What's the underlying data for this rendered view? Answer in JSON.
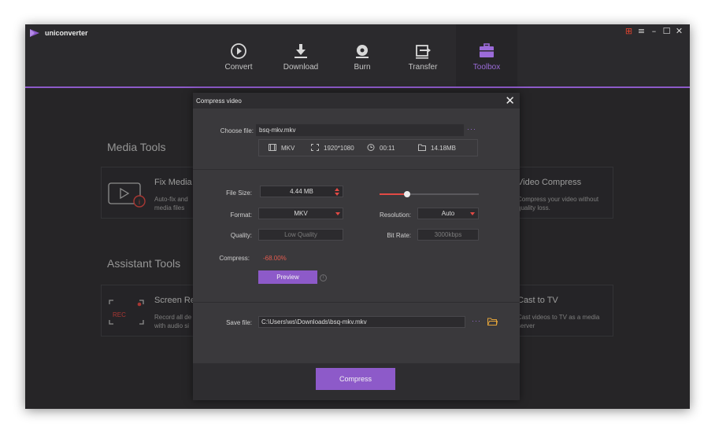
{
  "app": {
    "name": "uniconverter"
  },
  "nav": [
    {
      "label": "Convert",
      "icon": "convert-icon"
    },
    {
      "label": "Download",
      "icon": "download-icon"
    },
    {
      "label": "Burn",
      "icon": "burn-icon"
    },
    {
      "label": "Transfer",
      "icon": "transfer-icon"
    },
    {
      "label": "Toolbox",
      "icon": "toolbox-icon",
      "active": true
    }
  ],
  "toolbox": {
    "media_tools_title": "Media Tools",
    "assistant_tools_title": "Assistant Tools",
    "cards": {
      "fix_media": {
        "title": "Fix Media",
        "desc": "Auto-fix and\nmedia files"
      },
      "video_compress": {
        "title": "Video Compress",
        "desc": "Compress your video without\nquality loss."
      },
      "screen_recorder": {
        "title": "Screen Re",
        "desc": "Record all de\nwith audio si"
      },
      "cast_to_tv": {
        "title": "Cast to TV",
        "desc": "Cast videos to TV as a media\nserver"
      },
      "rec_label": "REC"
    }
  },
  "dialog": {
    "title": "Compress video",
    "choose_file_label": "Choose file:",
    "choose_file_value": "bsq-mkv.mkv",
    "info": {
      "format": "MKV",
      "resolution": "1920*1080",
      "duration": "00:11",
      "size": "14.18MB"
    },
    "file_size_label": "File Size:",
    "file_size_value": "4.44  MB",
    "format_label": "Format:",
    "format_value": "MKV",
    "quality_label": "Quality:",
    "quality_value": "Low Quality",
    "resolution_label": "Resolution:",
    "resolution_value": "Auto",
    "bitrate_label": "Bit Rate:",
    "bitrate_value": "3000kbps",
    "compress_label": "Compress:",
    "compress_value": "-68.00%",
    "preview_label": "Preview",
    "save_file_label": "Save file:",
    "save_file_value": "C:\\Users\\ws\\Downloads\\bsq-mkv.mkv",
    "compress_button": "Compress",
    "slider_level": 0.28
  },
  "colors": {
    "accent": "#8d5ac9",
    "danger": "#e24a45",
    "bg": "#333235"
  }
}
